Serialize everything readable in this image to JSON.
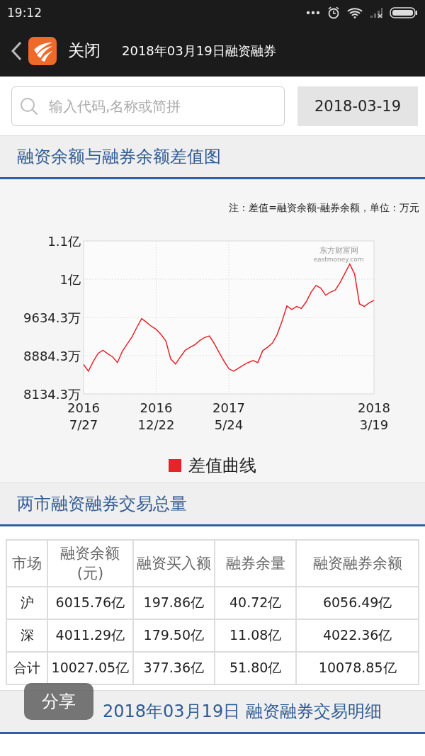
{
  "status_bar": {
    "time": "19:12"
  },
  "nav": {
    "close": "关闭",
    "title": "2018年03月19日融资融券"
  },
  "search": {
    "placeholder": "输入代码,名称或简拼",
    "date": "2018-03-19"
  },
  "chart_section": {
    "title": "融资余额与融券余额差值图",
    "note": "注：差值=融资余额-融券余额，单位：万元",
    "logo_text": "东方财富网",
    "logo_subtext": "eastmoney.com",
    "rounded_axis_labels": [
      "1.1亿",
      "1亿"
    ],
    "chart_data": {
      "type": "line",
      "grid": true,
      "ylim": [
        8134.3,
        11134.3
      ],
      "categories": [
        "2016\n7/27",
        null,
        null,
        null,
        null,
        null,
        null,
        null,
        null,
        null,
        null,
        null,
        null,
        null,
        null,
        "2016\n12/22",
        null,
        null,
        null,
        null,
        null,
        null,
        null,
        null,
        null,
        null,
        null,
        null,
        null,
        null,
        "2017\n5/24",
        null,
        null,
        null,
        null,
        null,
        null,
        null,
        null,
        null,
        null,
        null,
        null,
        null,
        null,
        null,
        null,
        null,
        null,
        null,
        null,
        null,
        null,
        null,
        null,
        null,
        null,
        null,
        null,
        null,
        "2018\n3/19"
      ],
      "series": [
        {
          "name": "差值曲线",
          "color": "#e8232a",
          "values": [
            8710,
            8580,
            8770,
            8930,
            8990,
            8920,
            8860,
            8750,
            8970,
            9110,
            9250,
            9440,
            9610,
            9540,
            9460,
            9400,
            9300,
            9170,
            8820,
            8720,
            8860,
            8990,
            9050,
            9100,
            9180,
            9240,
            9270,
            9120,
            8950,
            8780,
            8630,
            8580,
            8640,
            8700,
            8750,
            8790,
            8750,
            8980,
            9050,
            9130,
            9300,
            9560,
            9860,
            9790,
            9850,
            9810,
            9940,
            10130,
            10260,
            10210,
            10070,
            10130,
            10170,
            10320,
            10500,
            10680,
            10480,
            9900,
            9850,
            9920,
            9970
          ]
        }
      ],
      "yticks": [
        {
          "value": 8134.3,
          "label": "8134.3万"
        },
        {
          "value": 8884.3,
          "label": "8884.3万"
        },
        {
          "value": 9634.3,
          "label": "9634.3万"
        }
      ]
    }
  },
  "summary_section": {
    "title": "两市融资融券交易总量",
    "table": {
      "columns": [
        "市场",
        "融资余额(元)",
        "融资买入额",
        "融券余量",
        "融资融券余额"
      ],
      "rows": [
        [
          "沪",
          "6015.76亿",
          "197.86亿",
          "40.72亿",
          "6056.49亿"
        ],
        [
          "深",
          "4011.29亿",
          "179.50亿",
          "11.08亿",
          "4022.36亿"
        ],
        [
          "合计",
          "10027.05亿",
          "377.36亿",
          "51.80亿",
          "10078.85亿"
        ]
      ]
    }
  },
  "detail_section": {
    "title": "2018年03月19日 融资融券交易明细"
  },
  "share_button": {
    "label": "分享"
  }
}
